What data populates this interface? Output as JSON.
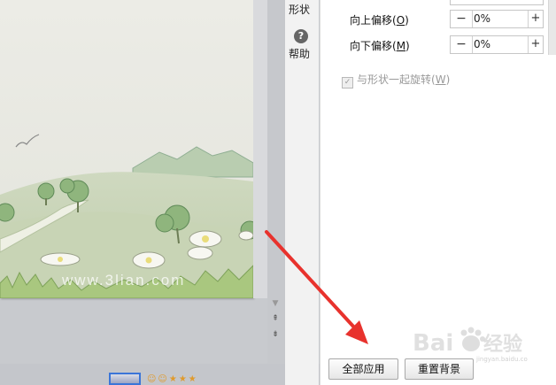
{
  "tool_column": {
    "shape_label": "形状",
    "help_label": "帮助",
    "help_glyph": "?"
  },
  "offset_settings": {
    "up_label": "向上偏移(",
    "up_key": "O",
    "up_value": "0%",
    "down_label": "向下偏移(",
    "down_key": "M",
    "down_value": "0%",
    "minus_glyph": "−",
    "plus_glyph": "+"
  },
  "rotate_option": {
    "label": "与形状一起旋转(",
    "key": "W",
    "checked": true
  },
  "buttons": {
    "apply_all": "全部应用",
    "reset_background": "重置背景"
  },
  "slide_image": {
    "text": "www.3lian.com"
  },
  "watermark": {
    "text": "Baidu经验",
    "sub": "jingyan.baidu.com"
  },
  "colors": {
    "annotation_arrow": "#e8322d",
    "panel_bg": "#ffffff"
  }
}
